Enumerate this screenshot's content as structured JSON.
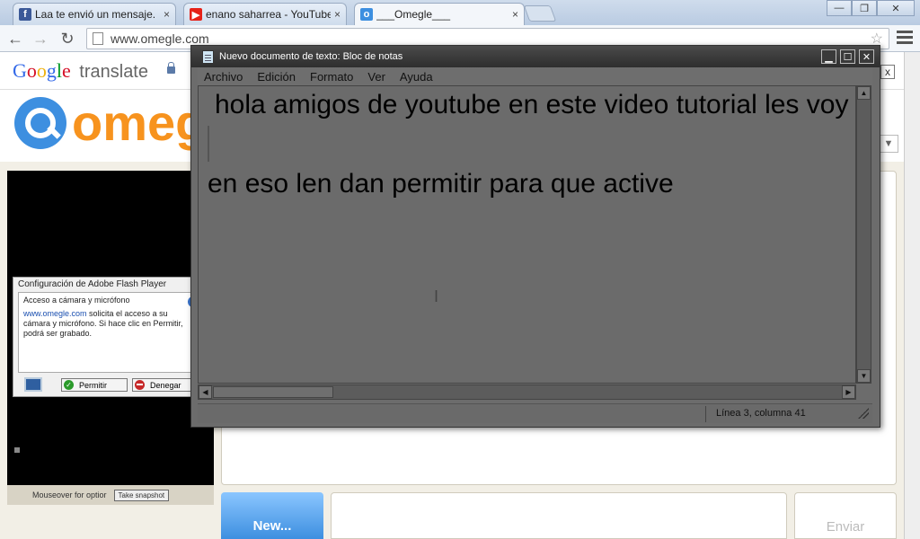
{
  "browser": {
    "tabs": [
      {
        "label": "Laa te envió un mensaje.",
        "icon": "facebook-icon",
        "color": "#3b5998"
      },
      {
        "label": "enano saharrea - YouTube",
        "icon": "youtube-icon",
        "color": "#e62117"
      },
      {
        "label": "___Omegle___",
        "icon": "omegle-icon",
        "color": "#3d8fe0"
      }
    ],
    "close_glyph": "×",
    "url": "www.omegle.com",
    "window_controls": [
      "—",
      "❐",
      "✕"
    ]
  },
  "google_translate": {
    "brand": "Google",
    "word": "translate",
    "close": "x"
  },
  "omegle": {
    "logo_text": "omegle",
    "new_button": "New...",
    "send_button": "Enviar",
    "mouseover_text": "Mouseover for optior",
    "snapshot_button": "Take snapshot"
  },
  "flash_dialog": {
    "title": "Configuración de Adobe Flash Player",
    "heading": "Acceso a cámara y micrófono",
    "link": "www.omegle.com",
    "message": " solicita el acceso a su cámara y micrófono. Si hace clic en Permitir, podrá ser grabado.",
    "help": "?",
    "allow": "Permitir",
    "deny": "Denegar"
  },
  "notepad": {
    "title": "Nuevo documento de texto: Bloc de notas",
    "menu": [
      "Archivo",
      "Edición",
      "Formato",
      "Ver",
      "Ayuda"
    ],
    "lines": [
      "hola amigos de youtube en este video tutorial les voy",
      "en eso len dan permitir para que active"
    ],
    "status": "Línea 3, columna 41"
  }
}
